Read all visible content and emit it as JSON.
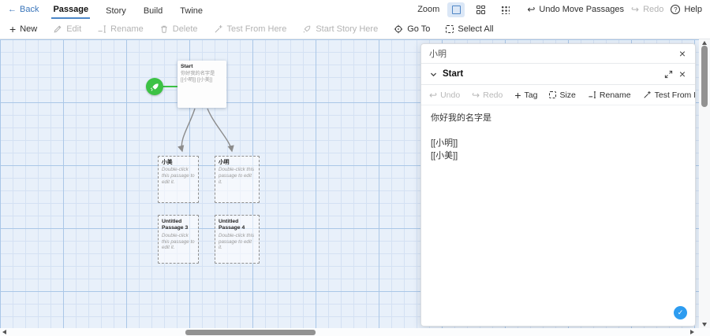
{
  "header": {
    "back": "Back",
    "tabs": [
      "Passage",
      "Story",
      "Build",
      "Twine"
    ],
    "active_tab": "Passage",
    "zoom_label": "Zoom",
    "undo_move": "Undo Move Passages",
    "redo": "Redo",
    "help": "Help",
    "help_glyph": "?"
  },
  "passage_toolbar": {
    "new": "New",
    "edit": "Edit",
    "rename": "Rename",
    "delete": "Delete",
    "test_from_here": "Test From Here",
    "start_story_here": "Start Story Here",
    "go_to": "Go To",
    "select_all": "Select All"
  },
  "canvas": {
    "start_passage": {
      "title": "Start",
      "excerpt": "你好我的名字是 [[小明]] [[小美]]"
    },
    "empty_excerpt": "Double-click this passage to edit it.",
    "passages": [
      {
        "title": "小美"
      },
      {
        "title": "小明"
      },
      {
        "title": "Untitled Passage 3"
      },
      {
        "title": "Untitled Passage 4"
      }
    ]
  },
  "panel": {
    "collapsed_title": "小明",
    "editor_title": "Start",
    "toolbar": {
      "undo": "Undo",
      "redo": "Redo",
      "tag": "Tag",
      "size": "Size",
      "rename": "Rename",
      "test_from_here": "Test From Here"
    },
    "text": "你好我的名字是\n\n[[小明]]\n[[小美]]",
    "close_glyph": "×",
    "check_glyph": "✓"
  },
  "glyphs": {
    "back_arrow": "←",
    "undo_arrow": "↩",
    "redo_arrow": "↪",
    "plus": "+"
  },
  "colors": {
    "accent": "#4d87c7",
    "start_green": "#3cc245",
    "check_blue": "#2d9cf0"
  }
}
